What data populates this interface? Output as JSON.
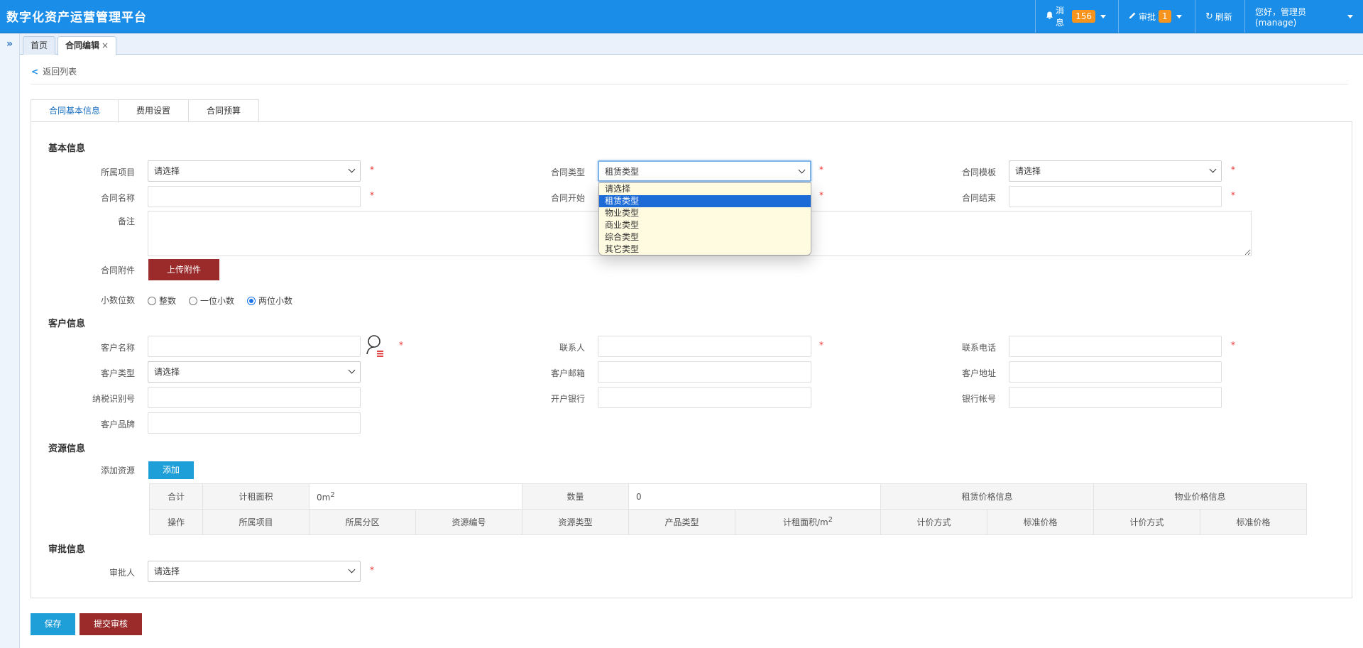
{
  "header": {
    "title": "数字化资产运营管理平台",
    "messages_label": "消息",
    "messages_count": "156",
    "approval_label": "审批",
    "approval_count": "1",
    "refresh_label": "刷新",
    "user_greeting": "您好，管理员(manage)"
  },
  "page_tabs": [
    {
      "label": "首页"
    },
    {
      "label": "合同编辑",
      "close": "×"
    }
  ],
  "back_label": "返回列表",
  "form_tabs": [
    "合同基本信息",
    "费用设置",
    "合同预算"
  ],
  "sections": {
    "basic": "基本信息",
    "customer": "客户信息",
    "resource": "资源信息",
    "approval": "审批信息"
  },
  "basic": {
    "project_label": "所属项目",
    "project_value": "请选择",
    "type_label": "合同类型",
    "type_value": "租赁类型",
    "template_label": "合同模板",
    "template_value": "请选择",
    "name_label": "合同名称",
    "start_label": "合同开始",
    "end_label": "合同结束",
    "remark_label": "备注",
    "attach_label": "合同附件",
    "upload_button": "上传附件",
    "decimal_label": "小数位数",
    "decimal_options": [
      "整数",
      "一位小数",
      "两位小数"
    ],
    "decimal_selected": "两位小数"
  },
  "contract_type_options": [
    "请选择",
    "租赁类型",
    "物业类型",
    "商业类型",
    "综合类型",
    "其它类型"
  ],
  "contract_type_highlighted": "租赁类型",
  "customer": {
    "name_label": "客户名称",
    "contact_label": "联系人",
    "phone_label": "联系电话",
    "type_label": "客户类型",
    "type_value": "请选择",
    "email_label": "客户邮箱",
    "address_label": "客户地址",
    "tax_label": "纳税识别号",
    "bank_label": "开户银行",
    "account_label": "银行帐号",
    "brand_label": "客户品牌"
  },
  "resource": {
    "add_label": "添加资源",
    "add_button": "添加",
    "summary": {
      "total": "合计",
      "area_label": "计租面积",
      "area_value": "0m",
      "area_sup": "2",
      "qty_label": "数量",
      "qty_value": "0",
      "rent_price": "租赁价格信息",
      "property_price": "物业价格信息"
    },
    "columns": [
      "操作",
      "所属项目",
      "所属分区",
      "资源编号",
      "资源类型",
      "产品类型",
      "计租面积/m",
      "计价方式",
      "标准价格",
      "计价方式",
      "标准价格"
    ],
    "area_col_sup": "2"
  },
  "approval": {
    "approver_label": "审批人",
    "approver_value": "请选择"
  },
  "footer": {
    "save_button": "保存",
    "submit_button": "提交审核"
  },
  "colors": {
    "header_bg": "#1a8de8",
    "badge": "#f7941d",
    "upload_btn": "#9b2b2b",
    "add_btn": "#1e9fd8",
    "save_btn": "#1e9fd8",
    "submit_btn": "#9b2b2b",
    "option_highlight": "#1c6bd6"
  }
}
